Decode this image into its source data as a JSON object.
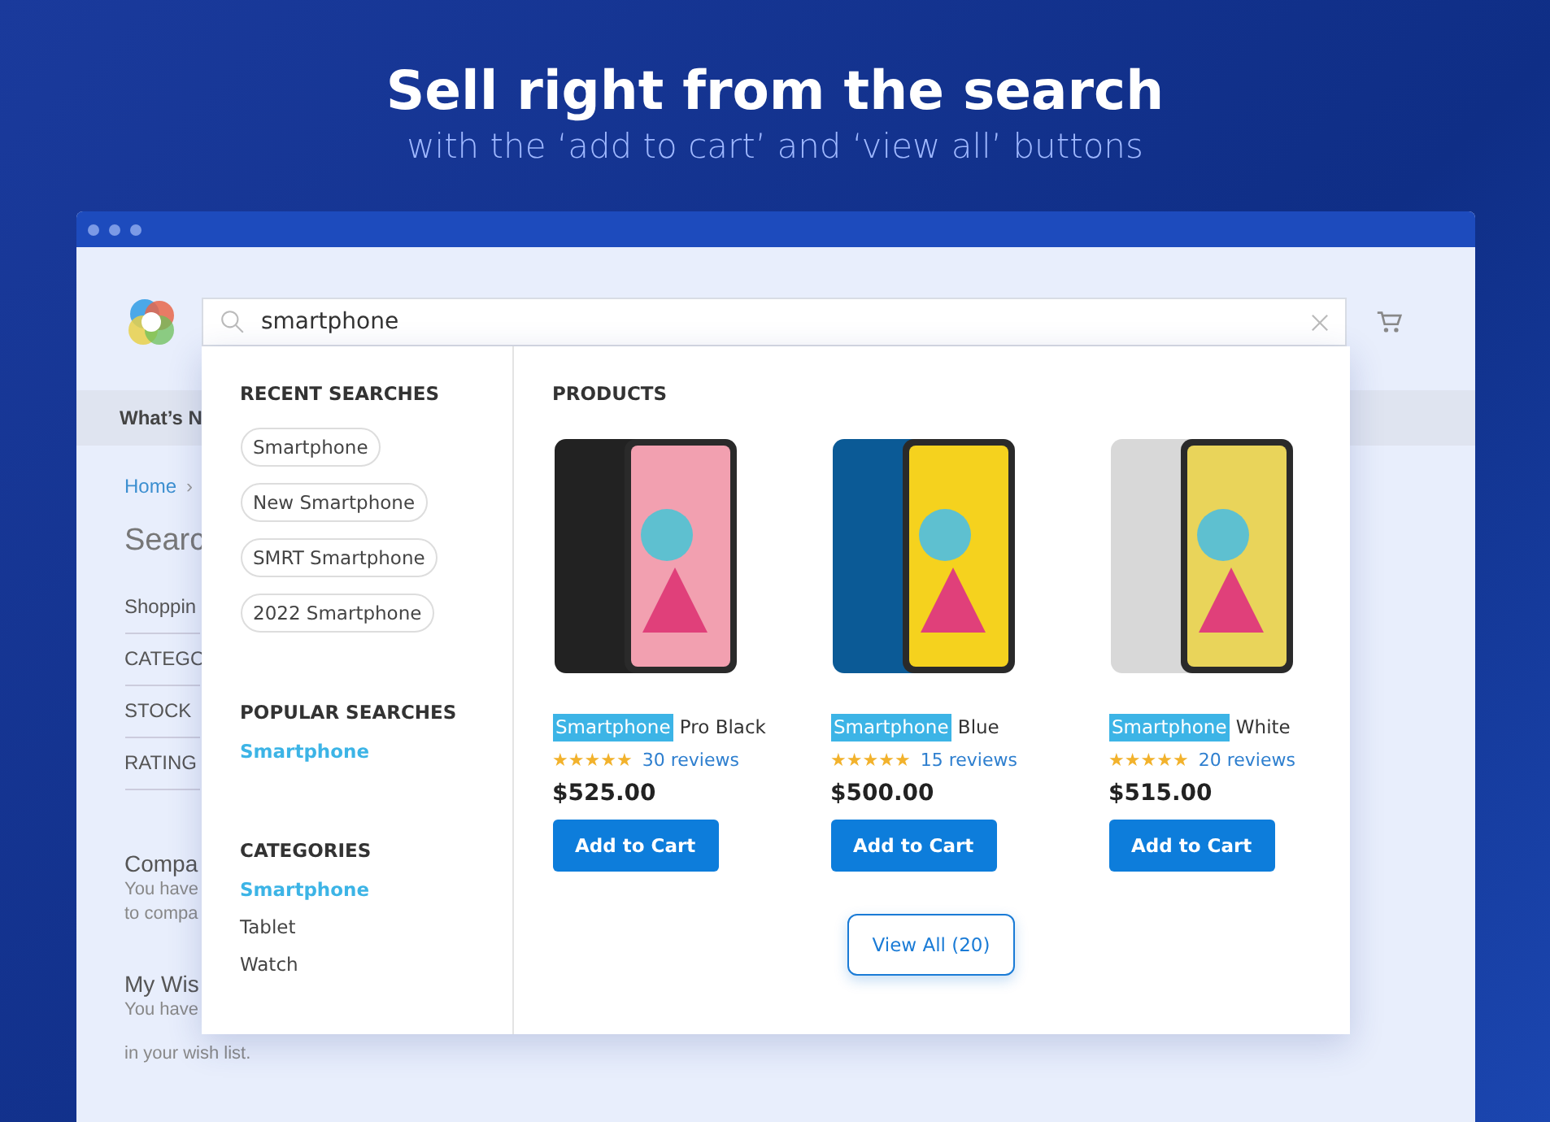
{
  "headline": "Sell right from the search",
  "subheadline": "with the ‘add to cart’ and ‘view all’ buttons",
  "search": {
    "value": "smartphone"
  },
  "page": {
    "nav": "What’s N",
    "breadcrumb": "Home",
    "breadcrumb_sep": "›",
    "title": "Searc",
    "sections": [
      "Shoppin",
      "CATEGO",
      "STOCK",
      "RATING"
    ],
    "compare": {
      "title": "Compa",
      "lines": [
        "You have",
        "to compa"
      ]
    },
    "wishlist": {
      "title": "My Wis",
      "lines": [
        "You have"
      ],
      "tail": "in your wish list."
    }
  },
  "recent": {
    "title": "RECENT SEARCHES",
    "items": [
      "Smartphone",
      "New Smartphone",
      "SMRT Smartphone",
      "2022 Smartphone"
    ]
  },
  "popular": {
    "title": "POPULAR SEARCHES",
    "items": [
      {
        "label": "Smartphone",
        "selected": true
      }
    ]
  },
  "categories": {
    "title": "CATEGORIES",
    "items": [
      {
        "label": "Smartphone",
        "selected": true
      },
      {
        "label": "Tablet",
        "selected": false
      },
      {
        "label": "Watch",
        "selected": false
      }
    ]
  },
  "products": {
    "title": "PRODUCTS",
    "items": [
      {
        "match": "Smartphone",
        "rest": "Pro Black",
        "stars": 5,
        "reviews": "30 reviews",
        "price": "$525.00",
        "button": "Add to Cart",
        "color": "#222222"
      },
      {
        "match": "Smartphone",
        "rest": "Blue",
        "stars": 5,
        "reviews": "15 reviews",
        "price": "$500.00",
        "button": "Add to Cart",
        "color": "#0b5a96"
      },
      {
        "match": "Smartphone",
        "rest": "White",
        "stars": 5,
        "reviews": "20 reviews",
        "price": "$515.00",
        "button": "Add to Cart",
        "color": "#d8d8d8"
      }
    ],
    "view_all": "View All (20)"
  }
}
